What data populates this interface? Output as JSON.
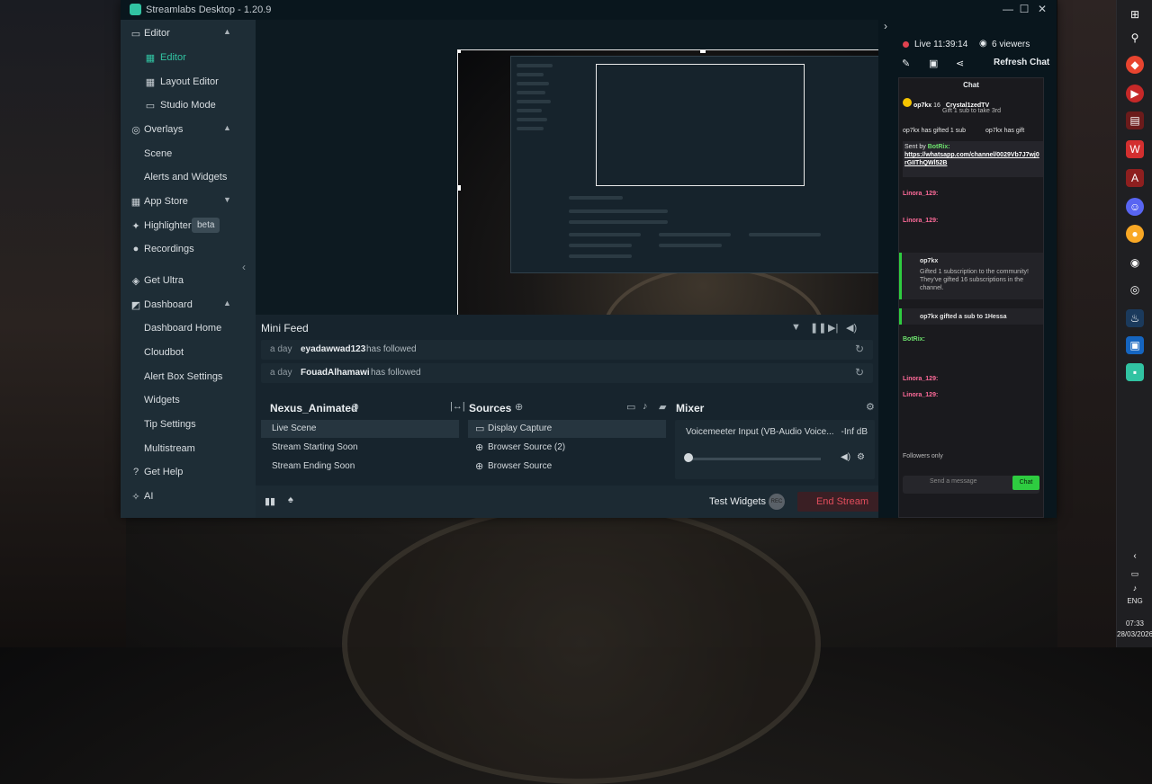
{
  "window": {
    "title": "Streamlabs Desktop - 1.20.9"
  },
  "sidebar": {
    "items": [
      {
        "label": "Editor"
      },
      {
        "label": "Editor"
      },
      {
        "label": "Layout Editor"
      },
      {
        "label": "Studio Mode"
      },
      {
        "label": "Overlays"
      },
      {
        "label": "Scene"
      },
      {
        "label": "Alerts and Widgets"
      },
      {
        "label": "App Store"
      },
      {
        "label": "Highlighter"
      },
      {
        "label": "Recordings"
      },
      {
        "label": "Get Ultra"
      },
      {
        "label": "Dashboard"
      },
      {
        "label": "Dashboard Home"
      },
      {
        "label": "Cloudbot"
      },
      {
        "label": "Alert Box Settings"
      },
      {
        "label": "Widgets"
      },
      {
        "label": "Tip Settings"
      },
      {
        "label": "Multistream"
      },
      {
        "label": "Get Help"
      },
      {
        "label": "AI"
      }
    ],
    "beta_badge": "beta"
  },
  "minifeed": {
    "title": "Mini Feed",
    "rows": [
      {
        "time": "a day",
        "user": "eyadawwad123",
        "action": "has followed"
      },
      {
        "time": "a day",
        "user": "FouadAlhamawi",
        "action": "has followed"
      }
    ]
  },
  "scenes": {
    "title": "Nexus_Animated",
    "items": [
      "Live Scene",
      "Stream Starting Soon",
      "Stream Ending Soon"
    ]
  },
  "sources": {
    "title": "Sources",
    "items": [
      "Display Capture",
      "Browser Source (2)",
      "Browser Source"
    ]
  },
  "mixer": {
    "title": "Mixer",
    "channel": "Voicemeeter Input (VB-Audio Voice...",
    "level": "-Inf dB"
  },
  "footer": {
    "test_widgets": "Test Widgets",
    "rec": "REC",
    "end_stream": "End Stream"
  },
  "right_panel": {
    "live": "Live 11:39:14",
    "viewers": "6 viewers",
    "refresh_chat": "Refresh Chat",
    "chat_title": "Chat",
    "top_user": "op7kx",
    "top_count": "16",
    "top_user2": "Crystal1zedTV",
    "top_sub_line": "Gift 1 sub to take 3rd",
    "gift_line": "op7kx has gifted 1 sub",
    "gift_line_b": "op7kx has gift",
    "sent_by": "Sent by",
    "botrix": "BotRix:",
    "link": "https://whatsapp.com/channel/0029Vb7J7wj0rGIIThQWl52B",
    "linora1": "Linora_129:",
    "linora2": "Linora_129:",
    "sub_card_user": "op7kx",
    "sub_card_text": "Gifted 1 subscription to the community! They've gifted 16 subscriptions in the channel.",
    "gift_to": "op7kx gifted a sub to 1Hessa",
    "linora3": "Linora_129:",
    "linora4": "Linora_129:",
    "botrix2": "BotRix:",
    "followers_only": "Followers only",
    "send_placeholder": "Send a message",
    "chat_button": "Chat"
  },
  "taskbar": {
    "lang": "ENG",
    "time": "07:33",
    "date": "28/03/2026"
  },
  "colors": {
    "accent": "#31c3a2",
    "live": "#e0424f",
    "chat_green": "#2ecc40"
  }
}
